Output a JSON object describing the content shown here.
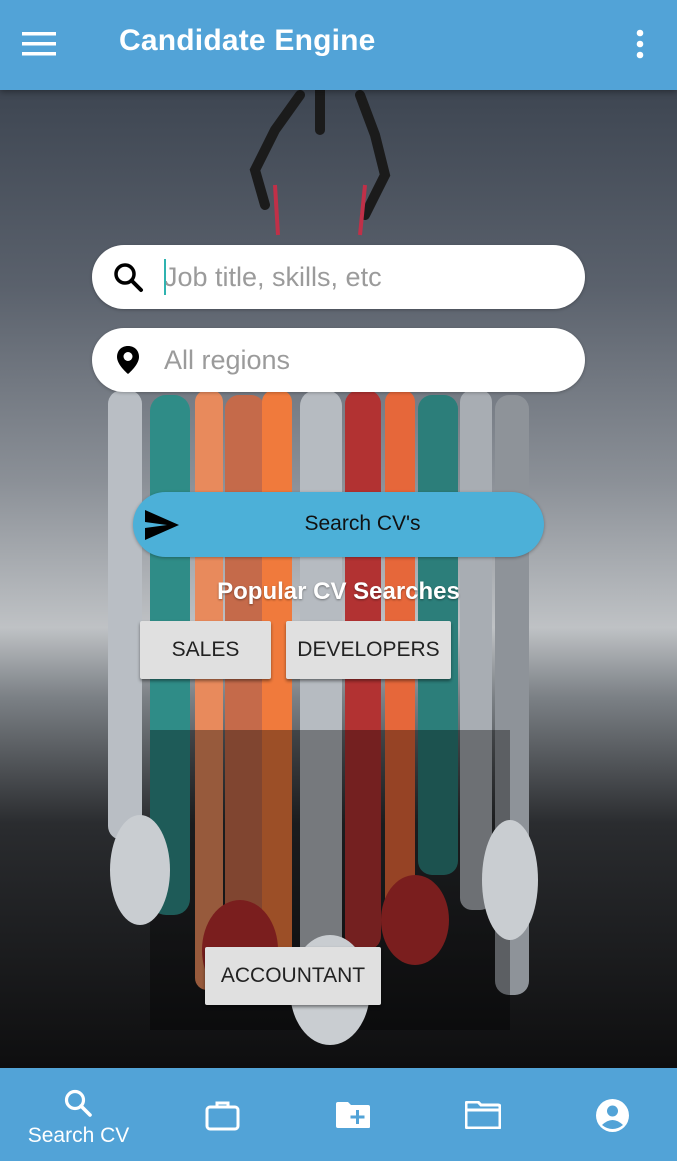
{
  "app_bar": {
    "title": "Candidate Engine",
    "menu_icon": "hamburger-menu-icon",
    "more_icon": "more-vert-icon"
  },
  "search": {
    "keywords_placeholder": "Job title, skills, etc",
    "keywords_value": "",
    "region_placeholder": "All regions",
    "region_value": "",
    "button_label": "Search CV's"
  },
  "popular": {
    "heading": "Popular CV Searches",
    "chips": [
      "SALES",
      "DEVELOPERS",
      "ACCOUNTANT"
    ]
  },
  "bottom_nav": {
    "items": [
      {
        "icon": "search-icon",
        "label": "Search CV",
        "active": true
      },
      {
        "icon": "briefcase-icon",
        "label": ""
      },
      {
        "icon": "folder-add-icon",
        "label": ""
      },
      {
        "icon": "folder-icon",
        "label": ""
      },
      {
        "icon": "account-circle-icon",
        "label": ""
      }
    ]
  },
  "colors": {
    "primary": "#52a3d7",
    "button": "#4cb0d8",
    "chip": "#e0e0e0"
  }
}
